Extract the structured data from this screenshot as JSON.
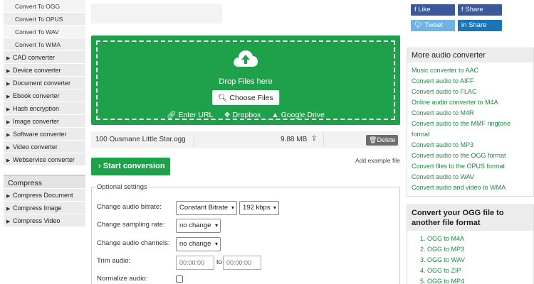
{
  "sidebar": {
    "sub_items": [
      "Convert To OGG",
      "Convert To OPUS",
      "Convert To WAV",
      "Convert To WMA"
    ],
    "categories": [
      "CAD converter",
      "Device converter",
      "Document converter",
      "Ebook converter",
      "Hash encryption",
      "Image converter",
      "Software converter",
      "Video converter",
      "Webservice converter"
    ],
    "compress_title": "Compress",
    "compress_items": [
      "Compress Document",
      "Compress Image",
      "Compress Video"
    ]
  },
  "upload": {
    "drop_text": "Drop Files here",
    "choose_label": "Choose Files",
    "url_label": "Enter URL",
    "dropbox_label": "Dropbox",
    "gdrive_label": "Google Drive"
  },
  "file": {
    "name": "100 Ousmane Little Star.ogg",
    "size": "9.88 MB",
    "delete_label": "Delete"
  },
  "add_example": "Add example file",
  "start_label": "Start conversion",
  "options": {
    "legend": "Optional settings",
    "bitrate_label": "Change audio bitrate:",
    "bitrate_mode": "Constant Bitrate",
    "bitrate_value": "192 kbps",
    "sampling_label": "Change sampling rate:",
    "sampling_value": "no change",
    "channels_label": "Change audio channels:",
    "channels_value": "no change",
    "trim_label": "Trim audio:",
    "trim_from": "00:00:00",
    "trim_to_label": "to",
    "trim_to": "00:00:00",
    "normalize_label": "Normalize audio:"
  },
  "social": {
    "like": "Like",
    "share_fb": "Share",
    "tweet": "Tweet",
    "share_li": "Share"
  },
  "more_audio": {
    "title": "More audio converter",
    "links": [
      "Music converter to AAC",
      "Convert audio to AIFF",
      "Convert audio to FLAC",
      "Online audio converter to M4A",
      "Convert audio to M4R",
      "Convert audio to the MMF ringtone format",
      "Convert audio to MP3",
      "Convert audio to the OGG format",
      "Convert files to the OPUS format",
      "Convert audio to WAV",
      "Convert audio and video to WMA"
    ]
  },
  "convert_ogg": {
    "title": "Convert your OGG file to another file format",
    "links": [
      "1. OGG to M4A",
      "2. OGG to MP3",
      "3. OGG to WAV",
      "4. OGG to ZIP",
      "5. OGG to MP4"
    ]
  },
  "colors": {
    "green": "#1fa04a",
    "link_green": "#1d8a3e",
    "facebook": "#3b5998",
    "twitter": "#6fb3e6",
    "linkedin": "#1a75b6"
  }
}
